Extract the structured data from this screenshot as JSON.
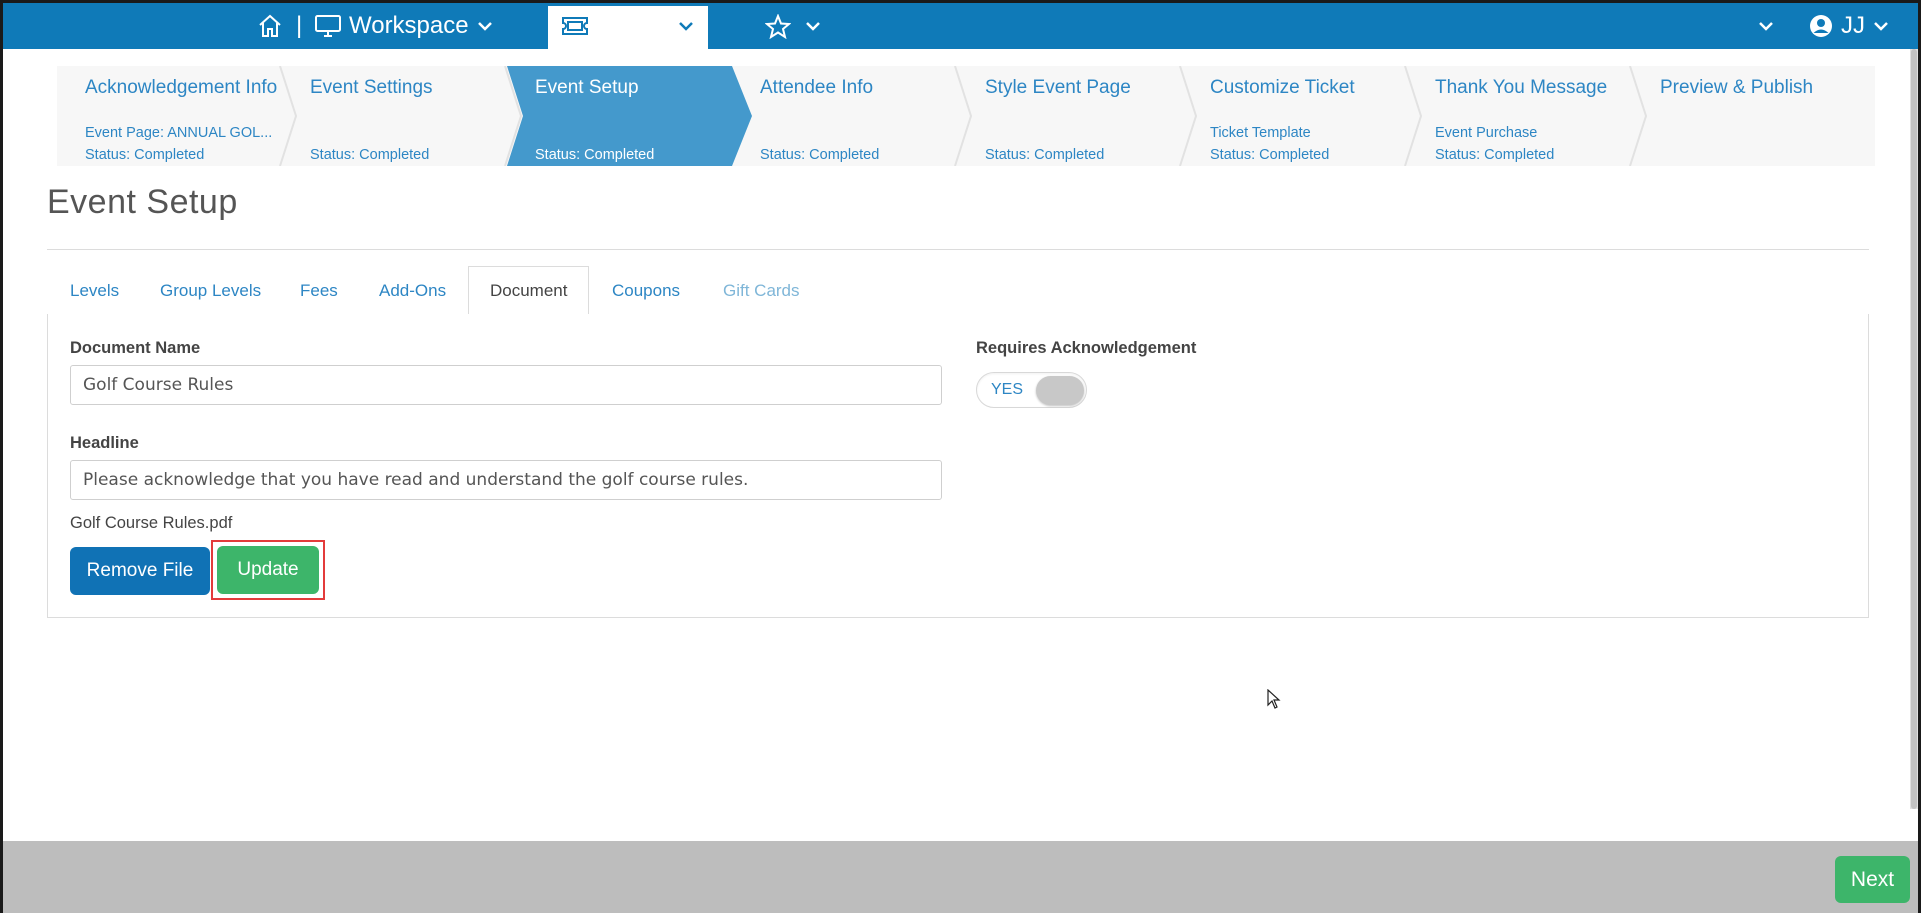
{
  "topbar": {
    "home_icon": "home-icon",
    "separator": "|",
    "workspace_label": "Workspace",
    "events_label": "Events",
    "favorites_icon": "star-icon",
    "user_initials": "JJ",
    "colors": {
      "bar": "#0f7ab8"
    }
  },
  "stepper": {
    "steps": [
      {
        "title": "Acknowledgement Info",
        "line1": "Event Page: ANNUAL GOL...",
        "line2": "Status: Completed",
        "active": false
      },
      {
        "title": "Event Settings",
        "line1": "",
        "line2": "Status: Completed",
        "active": false
      },
      {
        "title": "Event Setup",
        "line1": "",
        "line2": "Status: Completed",
        "active": true
      },
      {
        "title": "Attendee Info",
        "line1": "",
        "line2": "Status: Completed",
        "active": false
      },
      {
        "title": "Style Event Page",
        "line1": "",
        "line2": "Status: Completed",
        "active": false
      },
      {
        "title": "Customize Ticket",
        "line1": "Ticket Template",
        "line2": "Status: Completed",
        "active": false
      },
      {
        "title": "Thank You Message",
        "line1": "Event Purchase",
        "line2": "Status: Completed",
        "active": false
      },
      {
        "title": "Preview & Publish",
        "line1": "",
        "line2": "",
        "active": false
      }
    ],
    "active_color": "#4499cc"
  },
  "page": {
    "title": "Event Setup"
  },
  "tabs": {
    "items": [
      {
        "label": "Levels",
        "state": "normal"
      },
      {
        "label": "Group Levels",
        "state": "normal"
      },
      {
        "label": "Fees",
        "state": "normal"
      },
      {
        "label": "Add-Ons",
        "state": "normal"
      },
      {
        "label": "Document",
        "state": "active"
      },
      {
        "label": "Coupons",
        "state": "normal"
      },
      {
        "label": "Gift Cards",
        "state": "disabled"
      }
    ]
  },
  "document_form": {
    "document_name_label": "Document Name",
    "document_name_value": "Golf Course Rules",
    "headline_label": "Headline",
    "headline_value": "Please acknowledge that you have read and understand the golf course rules.",
    "file_name": "Golf Course Rules.pdf",
    "remove_file_label": "Remove File",
    "update_label": "Update",
    "requires_ack_label": "Requires Acknowledgement",
    "requires_ack_toggle": "YES"
  },
  "footer": {
    "next_label": "Next"
  }
}
